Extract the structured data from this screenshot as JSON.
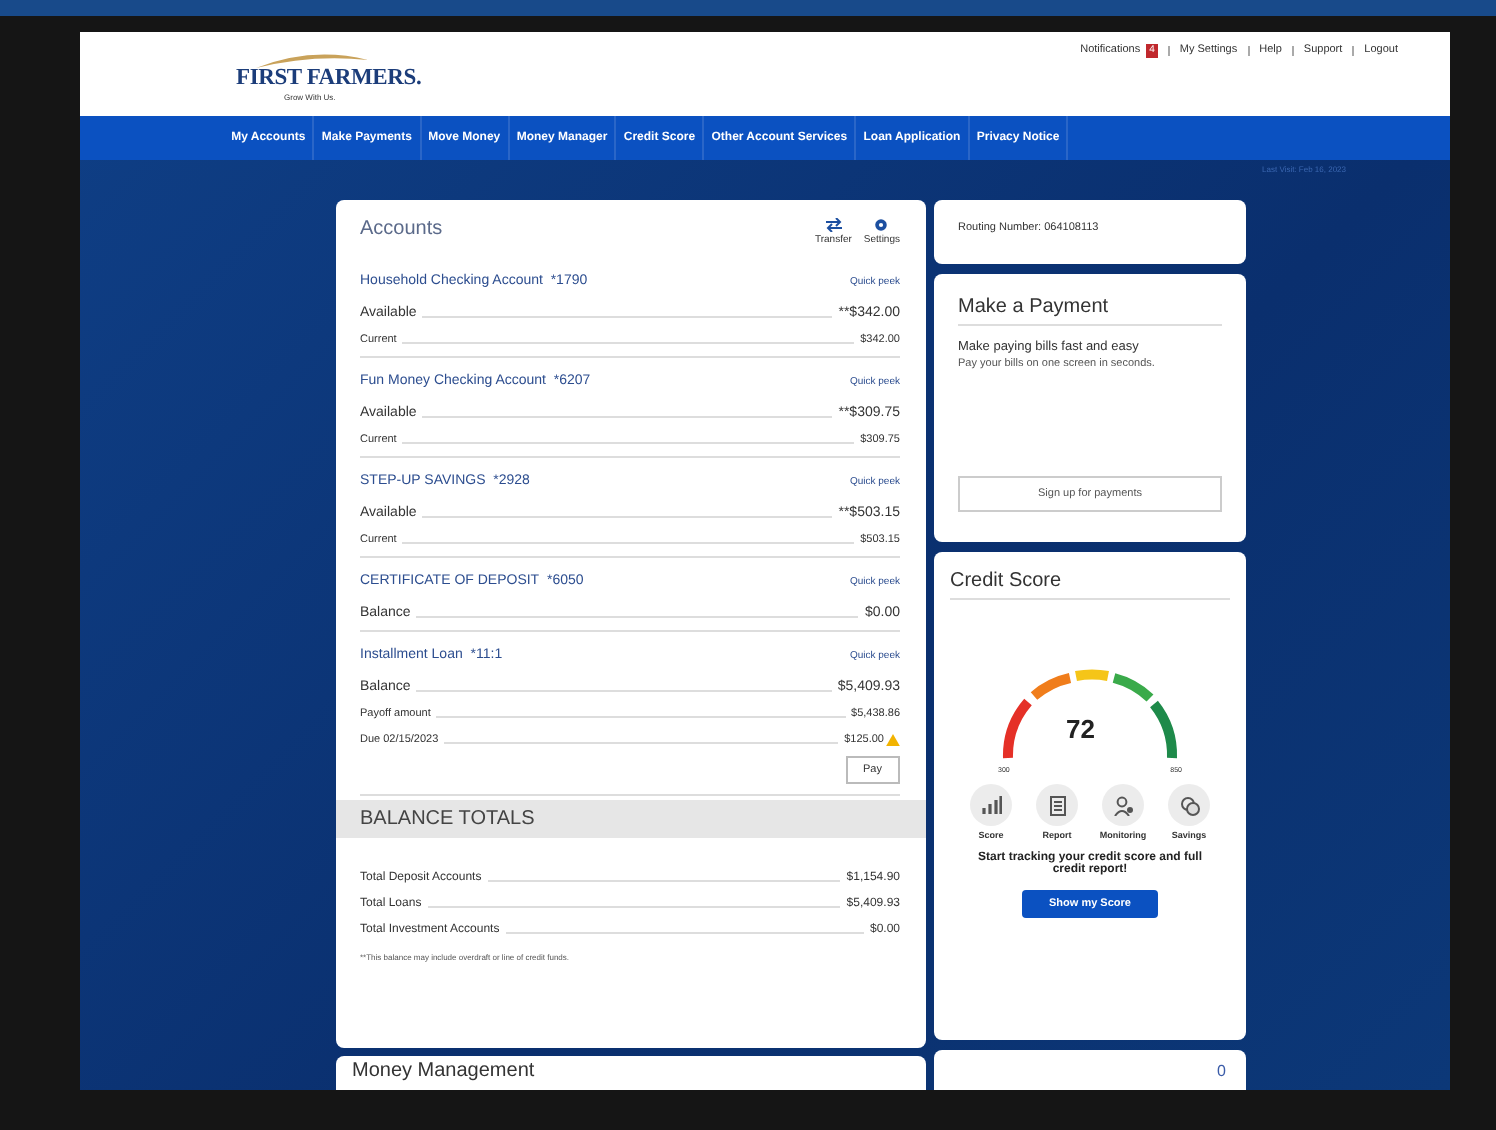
{
  "header": {
    "logo": "FIRST FARMERS.",
    "tagline": "Grow With Us.",
    "links": [
      {
        "label": "Notifications",
        "badge": "4"
      },
      {
        "label": "My Settings"
      },
      {
        "label": "Help"
      },
      {
        "label": "Support"
      },
      {
        "label": "Logout"
      }
    ]
  },
  "nav": [
    "My Accounts",
    "Make Payments",
    "Move Money",
    "Money Manager",
    "Credit Score",
    "Other Account Services",
    "Loan Application",
    "Privacy Notice"
  ],
  "last_visit": "Last Visit: Feb 16, 2023",
  "accounts": {
    "title": "Accounts",
    "actions": [
      {
        "kind": "transfer",
        "label": "Transfer"
      },
      {
        "kind": "settings",
        "label": "Settings"
      }
    ],
    "items": [
      {
        "name": "Household Checking Account",
        "number": "*1790",
        "link": "Quick peek",
        "lines": [
          {
            "label": "Available",
            "value": "**$342.00",
            "warning": false
          },
          {
            "label": "Current",
            "value": "$342.00",
            "warning": false
          }
        ]
      },
      {
        "name": "Fun Money Checking Account",
        "number": "*6207",
        "link": "Quick peek",
        "lines": [
          {
            "label": "Available",
            "value": "**$309.75",
            "warning": false
          },
          {
            "label": "Current",
            "value": "$309.75",
            "warning": false
          }
        ]
      },
      {
        "name": "STEP-UP SAVINGS",
        "number": "*2928",
        "link": "Quick peek",
        "lines": [
          {
            "label": "Available",
            "value": "**$503.15",
            "warning": false
          },
          {
            "label": "Current",
            "value": "$503.15",
            "warning": false
          }
        ]
      },
      {
        "name": "CERTIFICATE OF DEPOSIT",
        "number": "*6050",
        "link": "Quick peek",
        "lines": [
          {
            "label": "Balance",
            "value": "$0.00",
            "warning": false
          }
        ]
      },
      {
        "name": "Installment Loan",
        "number": "*11:1",
        "link": "Quick peek",
        "button": "Pay",
        "lines": [
          {
            "label": "Balance",
            "value": "$5,409.93",
            "warning": false
          },
          {
            "label": "Payoff amount",
            "value": "$5,438.86",
            "warning": false
          },
          {
            "label": "Due 02/15/2023",
            "value": "$125.00",
            "warning": true
          }
        ]
      }
    ],
    "totals_title": "BALANCE TOTALS",
    "totals": [
      {
        "label": "Total Deposit Accounts",
        "value": "$1,154.90"
      },
      {
        "label": "Total Loans",
        "value": "$5,409.93"
      },
      {
        "label": "Total Investment Accounts",
        "value": "$0.00"
      }
    ],
    "footnote": "**This balance may include overdraft or line of credit funds."
  },
  "money_management": {
    "title": "Money Management"
  },
  "routing": "Routing Number: 064108113",
  "payment": {
    "title": "Make a Payment",
    "headline": "Make paying bills fast and easy",
    "text": "Pay your bills on one screen in seconds.",
    "button": "Sign up for payments"
  },
  "credit": {
    "title": "Credit Score",
    "score": "72",
    "min": "300",
    "max": "850",
    "features": [
      {
        "kind": "score",
        "label": "Score"
      },
      {
        "kind": "report",
        "label": "Report"
      },
      {
        "kind": "monitoring",
        "label": "Monitoring"
      },
      {
        "kind": "savings",
        "label": "Savings"
      }
    ],
    "text": "Start tracking your credit score and full credit report!",
    "button": "Show my Score"
  },
  "bottom_card": {
    "count": "0"
  }
}
